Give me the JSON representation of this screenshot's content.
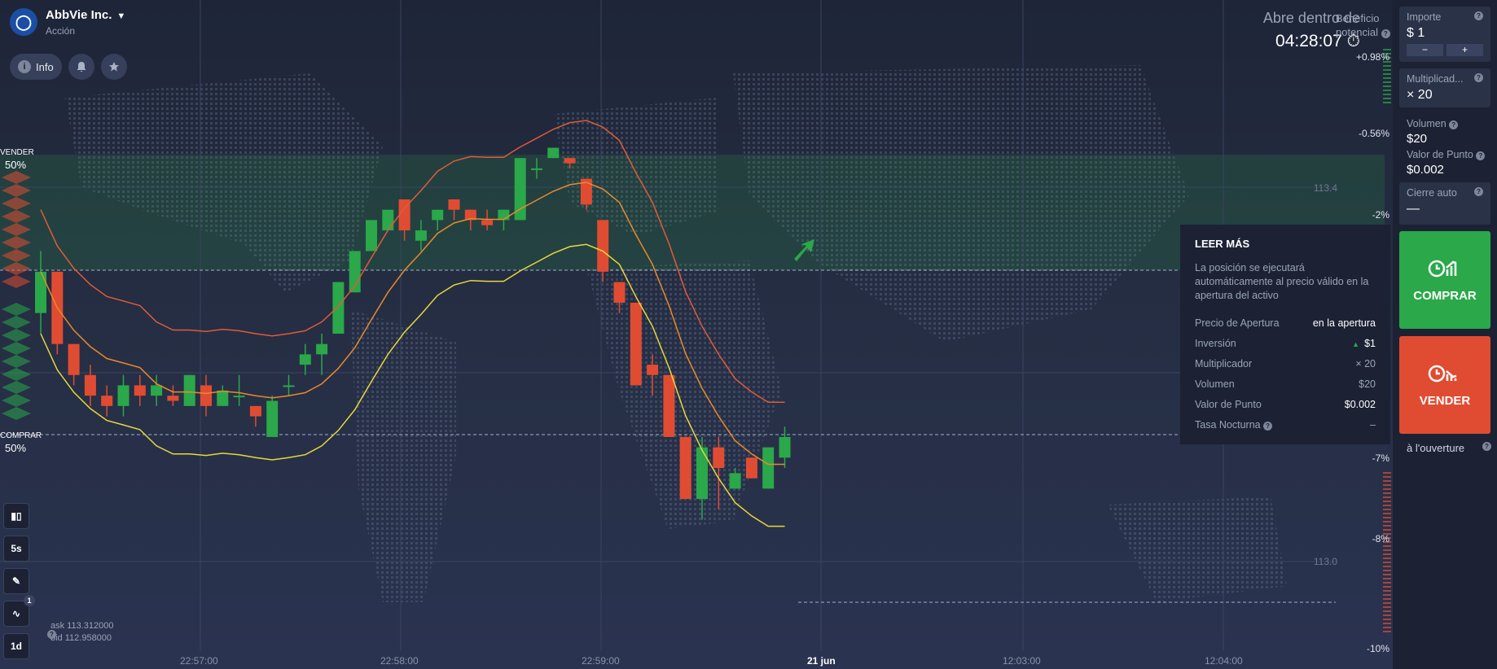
{
  "asset": {
    "name": "AbbVie Inc.",
    "type": "Acción"
  },
  "buttons": {
    "info": "Info"
  },
  "open_in": {
    "label": "Abre dentro de",
    "time": "04:28:07"
  },
  "benefit_label": "Beneficio potencial",
  "percent_axis": [
    "+0.98%",
    "-0.56%",
    "-2%",
    "-7%",
    "-8%",
    "-10%"
  ],
  "price_levels": [
    "113.4",
    "113.0"
  ],
  "time_axis": [
    "22:57:00",
    "22:58:00",
    "22:59:00",
    "21 jun",
    "12:03:00",
    "12:04:00"
  ],
  "sentiment": {
    "sell_label": "VENDER",
    "sell_pct": "50%",
    "buy_label": "COMPRAR",
    "buy_pct": "50%"
  },
  "tools": {
    "timeframe": "5s",
    "period": "1d",
    "indicator_count": "1"
  },
  "quote": {
    "ask": "ask 113.312000",
    "bid": "bid 112.958000"
  },
  "tooltip": {
    "title": "LEER MÁS",
    "desc": "La posición se ejecutará automáticamente al precio válido en la apertura del activo",
    "rows": [
      {
        "label": "Precio de Apertura",
        "value": "en la apertura"
      },
      {
        "label": "Inversión",
        "value": "$1"
      },
      {
        "label": "Multiplicador",
        "value": "× 20"
      },
      {
        "label": "Volumen",
        "value": "$20"
      },
      {
        "label": "Valor de Punto",
        "value": "$0.002"
      },
      {
        "label": "Tasa Nocturna",
        "value": "–"
      }
    ]
  },
  "panel": {
    "amount_label": "Importe",
    "amount_value": "$ 1",
    "minus": "−",
    "plus": "+",
    "mult_label": "Multiplicad...",
    "mult_value": "× 20",
    "volume_label": "Volumen",
    "volume_value": "$20",
    "point_label": "Valor de Punto",
    "point_value": "$0.002",
    "auto_label": "Cierre auto",
    "auto_value": "—",
    "buy_label": "COMPRAR",
    "sell_label": "VENDER",
    "open_label": "à l'ouverture"
  },
  "colors": {
    "up": "#2aa84a",
    "down": "#e04c32",
    "bb_outer": "#e05a3a",
    "bb_mid": "#e88a2a",
    "bb_inner": "#e8d83a"
  },
  "chart_data": {
    "type": "candlestick",
    "price_levels": [
      113.4,
      113.0
    ],
    "candles": [
      {
        "o": 62,
        "c": 66,
        "h": 68,
        "l": 60
      },
      {
        "o": 66,
        "c": 59,
        "h": 66,
        "l": 58
      },
      {
        "o": 59,
        "c": 56,
        "h": 59,
        "l": 55
      },
      {
        "o": 56,
        "c": 54,
        "h": 57,
        "l": 53
      },
      {
        "o": 54,
        "c": 53,
        "h": 55,
        "l": 52
      },
      {
        "o": 53,
        "c": 55,
        "h": 56,
        "l": 52
      },
      {
        "o": 55,
        "c": 54,
        "h": 56,
        "l": 53
      },
      {
        "o": 54,
        "c": 55,
        "h": 56,
        "l": 53
      },
      {
        "o": 54,
        "c": 53.5,
        "h": 55,
        "l": 53
      },
      {
        "o": 53,
        "c": 56,
        "h": 56,
        "l": 53
      },
      {
        "o": 55,
        "c": 53,
        "h": 56,
        "l": 52
      },
      {
        "o": 53,
        "c": 54.5,
        "h": 55,
        "l": 53
      },
      {
        "o": 54,
        "c": 54,
        "h": 56,
        "l": 53
      },
      {
        "o": 53,
        "c": 52,
        "h": 53,
        "l": 51
      },
      {
        "o": 50,
        "c": 53.5,
        "h": 54,
        "l": 50
      },
      {
        "o": 55,
        "c": 55,
        "h": 56,
        "l": 54
      },
      {
        "o": 57,
        "c": 58,
        "h": 59,
        "l": 56
      },
      {
        "o": 58,
        "c": 59,
        "h": 60,
        "l": 56
      },
      {
        "o": 60,
        "c": 65,
        "h": 65,
        "l": 60
      },
      {
        "o": 64,
        "c": 68,
        "h": 68,
        "l": 64
      },
      {
        "o": 68,
        "c": 71,
        "h": 71,
        "l": 68
      },
      {
        "o": 70,
        "c": 72,
        "h": 72,
        "l": 70
      },
      {
        "o": 73,
        "c": 70,
        "h": 73,
        "l": 69
      },
      {
        "o": 69,
        "c": 70,
        "h": 71,
        "l": 68
      },
      {
        "o": 71,
        "c": 72,
        "h": 72,
        "l": 70
      },
      {
        "o": 73,
        "c": 72,
        "h": 73,
        "l": 71
      },
      {
        "o": 72,
        "c": 71,
        "h": 72,
        "l": 70
      },
      {
        "o": 71,
        "c": 70.5,
        "h": 72,
        "l": 70
      },
      {
        "o": 71,
        "c": 72,
        "h": 72,
        "l": 70
      },
      {
        "o": 71,
        "c": 77,
        "h": 77,
        "l": 71
      },
      {
        "o": 76,
        "c": 76,
        "h": 77,
        "l": 75
      },
      {
        "o": 77,
        "c": 78,
        "h": 78,
        "l": 77
      },
      {
        "o": 77,
        "c": 76.5,
        "h": 77,
        "l": 76
      },
      {
        "o": 75,
        "c": 72.5,
        "h": 75,
        "l": 72
      },
      {
        "o": 71,
        "c": 66,
        "h": 71,
        "l": 65
      },
      {
        "o": 65,
        "c": 63,
        "h": 65,
        "l": 62
      },
      {
        "o": 63,
        "c": 55,
        "h": 63,
        "l": 55
      },
      {
        "o": 57,
        "c": 56,
        "h": 58,
        "l": 54
      },
      {
        "o": 56,
        "c": 50,
        "h": 56,
        "l": 50
      },
      {
        "o": 50,
        "c": 44,
        "h": 50,
        "l": 44
      },
      {
        "o": 44,
        "c": 49,
        "h": 50,
        "l": 42
      },
      {
        "o": 49,
        "c": 47,
        "h": 50,
        "l": 43
      },
      {
        "o": 45,
        "c": 46.5,
        "h": 47,
        "l": 45
      },
      {
        "o": 48,
        "c": 46,
        "h": 48,
        "l": 46
      },
      {
        "o": 45,
        "c": 49,
        "h": 49,
        "l": 45
      },
      {
        "o": 48,
        "c": 50,
        "h": 51,
        "l": 47
      }
    ]
  }
}
